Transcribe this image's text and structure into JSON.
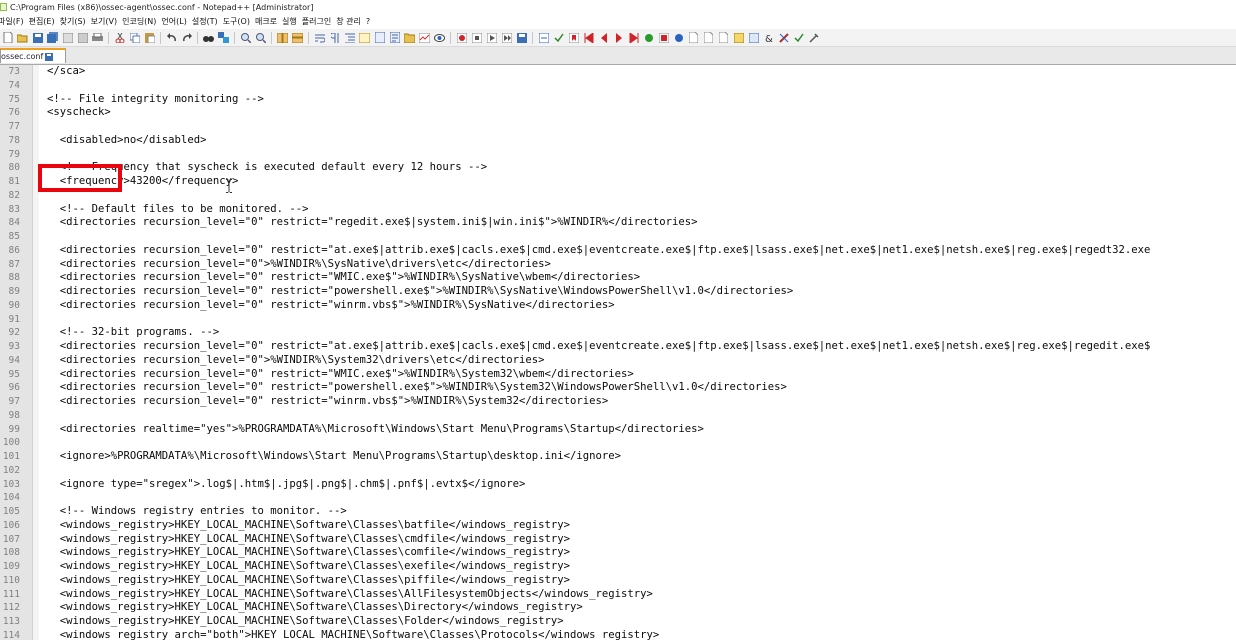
{
  "window": {
    "title": "C:\\Program Files (x86)\\ossec-agent\\ossec.conf - Notepad++ [Administrator]"
  },
  "menu": [
    "파일(F)",
    "편집(E)",
    "찾기(S)",
    "보기(V)",
    "인코딩(N)",
    "언어(L)",
    "설정(T)",
    "도구(O)",
    "매크로",
    "실행",
    "플러그인",
    "창 관리",
    "?"
  ],
  "tab": {
    "label": "ossec.conf"
  },
  "editor": {
    "lines": [
      {
        "num": "73",
        "text": "</sca>"
      },
      {
        "num": "74",
        "text": ""
      },
      {
        "num": "75",
        "text": "<!-- File integrity monitoring -->"
      },
      {
        "num": "76",
        "text": "<syscheck>"
      },
      {
        "num": "77",
        "text": ""
      },
      {
        "num": "78",
        "text": "  <disabled>no</disabled>"
      },
      {
        "num": "79",
        "text": ""
      },
      {
        "num": "80",
        "text": "  <!-- Frequency that syscheck is executed default every 12 hours -->"
      },
      {
        "num": "81",
        "text": "  <frequency>43200</frequency>"
      },
      {
        "num": "82",
        "text": ""
      },
      {
        "num": "83",
        "text": "  <!-- Default files to be monitored. -->"
      },
      {
        "num": "84",
        "text": "  <directories recursion_level=\"0\" restrict=\"regedit.exe$|system.ini$|win.ini$\">%WINDIR%</directories>"
      },
      {
        "num": "85",
        "text": ""
      },
      {
        "num": "86",
        "text": "  <directories recursion_level=\"0\" restrict=\"at.exe$|attrib.exe$|cacls.exe$|cmd.exe$|eventcreate.exe$|ftp.exe$|lsass.exe$|net.exe$|net1.exe$|netsh.exe$|reg.exe$|regedt32.exe"
      },
      {
        "num": "87",
        "text": "  <directories recursion_level=\"0\">%WINDIR%\\SysNative\\drivers\\etc</directories>"
      },
      {
        "num": "88",
        "text": "  <directories recursion_level=\"0\" restrict=\"WMIC.exe$\">%WINDIR%\\SysNative\\wbem</directories>"
      },
      {
        "num": "89",
        "text": "  <directories recursion_level=\"0\" restrict=\"powershell.exe$\">%WINDIR%\\SysNative\\WindowsPowerShell\\v1.0</directories>"
      },
      {
        "num": "90",
        "text": "  <directories recursion_level=\"0\" restrict=\"winrm.vbs$\">%WINDIR%\\SysNative</directories>"
      },
      {
        "num": "91",
        "text": ""
      },
      {
        "num": "92",
        "text": "  <!-- 32-bit programs. -->"
      },
      {
        "num": "93",
        "text": "  <directories recursion_level=\"0\" restrict=\"at.exe$|attrib.exe$|cacls.exe$|cmd.exe$|eventcreate.exe$|ftp.exe$|lsass.exe$|net.exe$|net1.exe$|netsh.exe$|reg.exe$|regedit.exe$"
      },
      {
        "num": "94",
        "text": "  <directories recursion_level=\"0\">%WINDIR%\\System32\\drivers\\etc</directories>"
      },
      {
        "num": "95",
        "text": "  <directories recursion_level=\"0\" restrict=\"WMIC.exe$\">%WINDIR%\\System32\\wbem</directories>"
      },
      {
        "num": "96",
        "text": "  <directories recursion_level=\"0\" restrict=\"powershell.exe$\">%WINDIR%\\System32\\WindowsPowerShell\\v1.0</directories>"
      },
      {
        "num": "97",
        "text": "  <directories recursion_level=\"0\" restrict=\"winrm.vbs$\">%WINDIR%\\System32</directories>"
      },
      {
        "num": "98",
        "text": ""
      },
      {
        "num": "99",
        "text": "  <directories realtime=\"yes\">%PROGRAMDATA%\\Microsoft\\Windows\\Start Menu\\Programs\\Startup</directories>"
      },
      {
        "num": "100",
        "text": ""
      },
      {
        "num": "101",
        "text": "  <ignore>%PROGRAMDATA%\\Microsoft\\Windows\\Start Menu\\Programs\\Startup\\desktop.ini</ignore>"
      },
      {
        "num": "102",
        "text": ""
      },
      {
        "num": "103",
        "text": "  <ignore type=\"sregex\">.log$|.htm$|.jpg$|.png$|.chm$|.pnf$|.evtx$</ignore>"
      },
      {
        "num": "104",
        "text": ""
      },
      {
        "num": "105",
        "text": "  <!-- Windows registry entries to monitor. -->"
      },
      {
        "num": "106",
        "text": "  <windows_registry>HKEY_LOCAL_MACHINE\\Software\\Classes\\batfile</windows_registry>"
      },
      {
        "num": "107",
        "text": "  <windows_registry>HKEY_LOCAL_MACHINE\\Software\\Classes\\cmdfile</windows_registry>"
      },
      {
        "num": "108",
        "text": "  <windows_registry>HKEY_LOCAL_MACHINE\\Software\\Classes\\comfile</windows_registry>"
      },
      {
        "num": "109",
        "text": "  <windows_registry>HKEY_LOCAL_MACHINE\\Software\\Classes\\exefile</windows_registry>"
      },
      {
        "num": "110",
        "text": "  <windows_registry>HKEY_LOCAL_MACHINE\\Software\\Classes\\piffile</windows_registry>"
      },
      {
        "num": "111",
        "text": "  <windows_registry>HKEY_LOCAL_MACHINE\\Software\\Classes\\AllFilesystemObjects</windows_registry>"
      },
      {
        "num": "112",
        "text": "  <windows_registry>HKEY_LOCAL_MACHINE\\Software\\Classes\\Directory</windows_registry>"
      },
      {
        "num": "113",
        "text": "  <windows_registry>HKEY_LOCAL_MACHINE\\Software\\Classes\\Folder</windows_registry>"
      },
      {
        "num": "114",
        "text": "  <windows_registry arch=\"both\">HKEY_LOCAL_MACHINE\\Software\\Classes\\Protocols</windows_registry>"
      }
    ]
  },
  "colors": {
    "highlight_border": "#e8050d",
    "tab_accent": "#f0a020",
    "gutter_bg": "#e4e4e4"
  }
}
